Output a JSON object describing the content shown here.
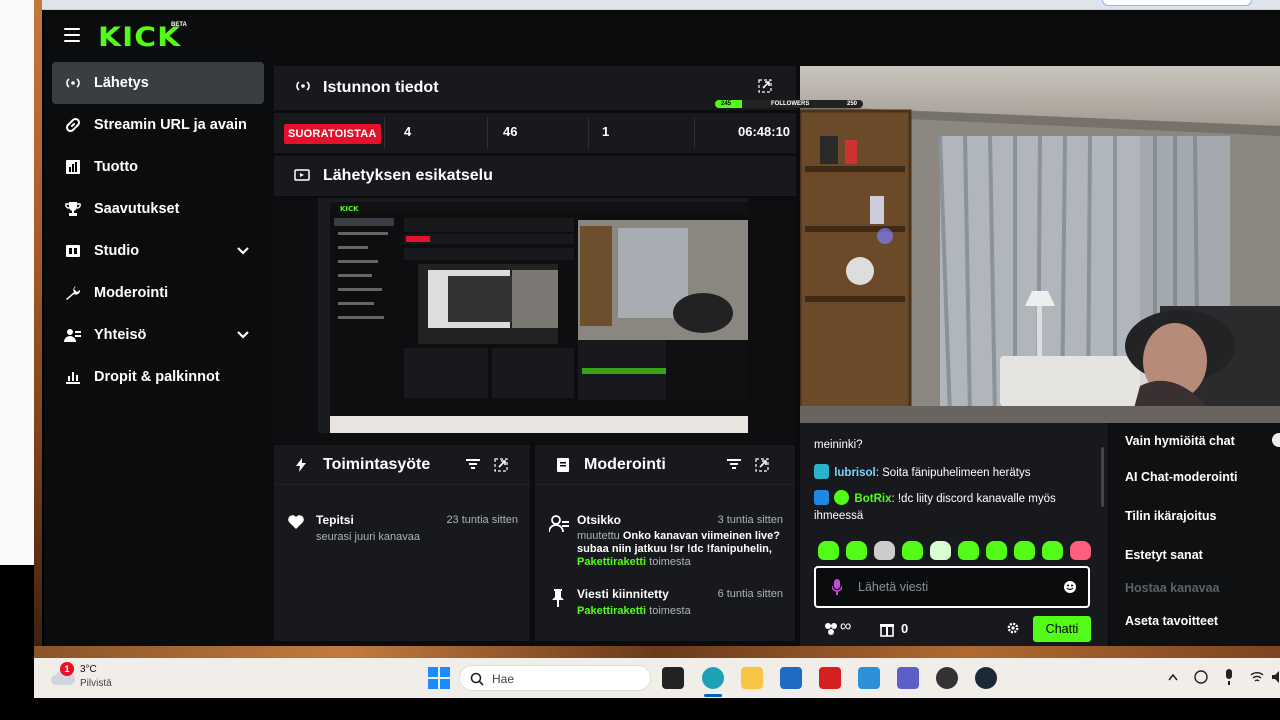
{
  "app": {
    "logo": "KICK",
    "logo_badge": "BETA"
  },
  "sidebar": {
    "items": [
      {
        "label": "Lähetys",
        "icon": "broadcast-icon"
      },
      {
        "label": "Streamin URL ja avain",
        "icon": "link-icon"
      },
      {
        "label": "Tuotto",
        "icon": "chart-icon"
      },
      {
        "label": "Saavutukset",
        "icon": "trophy-icon"
      },
      {
        "label": "Studio",
        "icon": "studio-icon"
      },
      {
        "label": "Moderointi",
        "icon": "wrench-icon"
      },
      {
        "label": "Yhteisö",
        "icon": "community-icon"
      },
      {
        "label": "Dropit & palkinnot",
        "icon": "drops-icon"
      }
    ]
  },
  "session": {
    "title": "Istunnon tiedot",
    "live_badge": "SUORATOISTAA",
    "stat_1": "4",
    "stat_2": "46",
    "stat_3": "1",
    "duration": "06:48:10"
  },
  "preview": {
    "title": "Lähetyksen esikatselu"
  },
  "overlay": {
    "followers_label": "FOLLOWERS",
    "followers_start": "245",
    "followers_goal": "250"
  },
  "activity": {
    "title": "Toimintasyöte",
    "items": [
      {
        "name": "Tepitsi",
        "time": "23 tuntia sitten",
        "desc": "seurasi juuri kanavaa"
      }
    ]
  },
  "moderation": {
    "title": "Moderointi",
    "items": [
      {
        "title": "Otsikko",
        "time": "3 tuntia sitten",
        "prefix": "muutettu",
        "desc": "Onko kanavan viimeinen live? subaa niin jatkuu !sr !dc !fanipuhelin,",
        "user": "Pakettiraketti",
        "suffix": "toimesta"
      },
      {
        "title": "Viesti kiinnitetty",
        "time": "6 tuntia sitten",
        "user": "Pakettiraketti",
        "suffix": "toimesta"
      }
    ]
  },
  "chat": {
    "messages": [
      {
        "user": "",
        "text": "meininki?"
      },
      {
        "user": "lubrisol",
        "text": "Soita fänipuhelimeen herätys",
        "color": "#7fd3ff"
      },
      {
        "user": "BotRix",
        "text": "!dc liity discord kanavalle myös ihmeessä",
        "color": "#53fc18"
      }
    ],
    "input_placeholder": "Lähetä viesti",
    "send_label": "Chatti",
    "viewers_icon_text": "∞",
    "points": "0"
  },
  "chat_menu": {
    "items": [
      {
        "label": "Vain hymiöitä chat",
        "disabled": false
      },
      {
        "label": "AI Chat-moderointi",
        "disabled": false
      },
      {
        "label": "Tilin ikärajoitus",
        "disabled": false
      },
      {
        "label": "Estetyt sanat",
        "disabled": false
      },
      {
        "label": "Hostaa kanavaa",
        "disabled": true
      },
      {
        "label": "Aseta tavoitteet",
        "disabled": false
      }
    ]
  },
  "taskbar": {
    "weather_temp": "3°C",
    "weather_desc": "Pilvistä",
    "weather_badge": "1",
    "search_placeholder": "Hae"
  },
  "colors": {
    "accent": "#53fc18",
    "live": "#e3112b",
    "panel": "#18191c",
    "background": "#0b0c0d"
  }
}
